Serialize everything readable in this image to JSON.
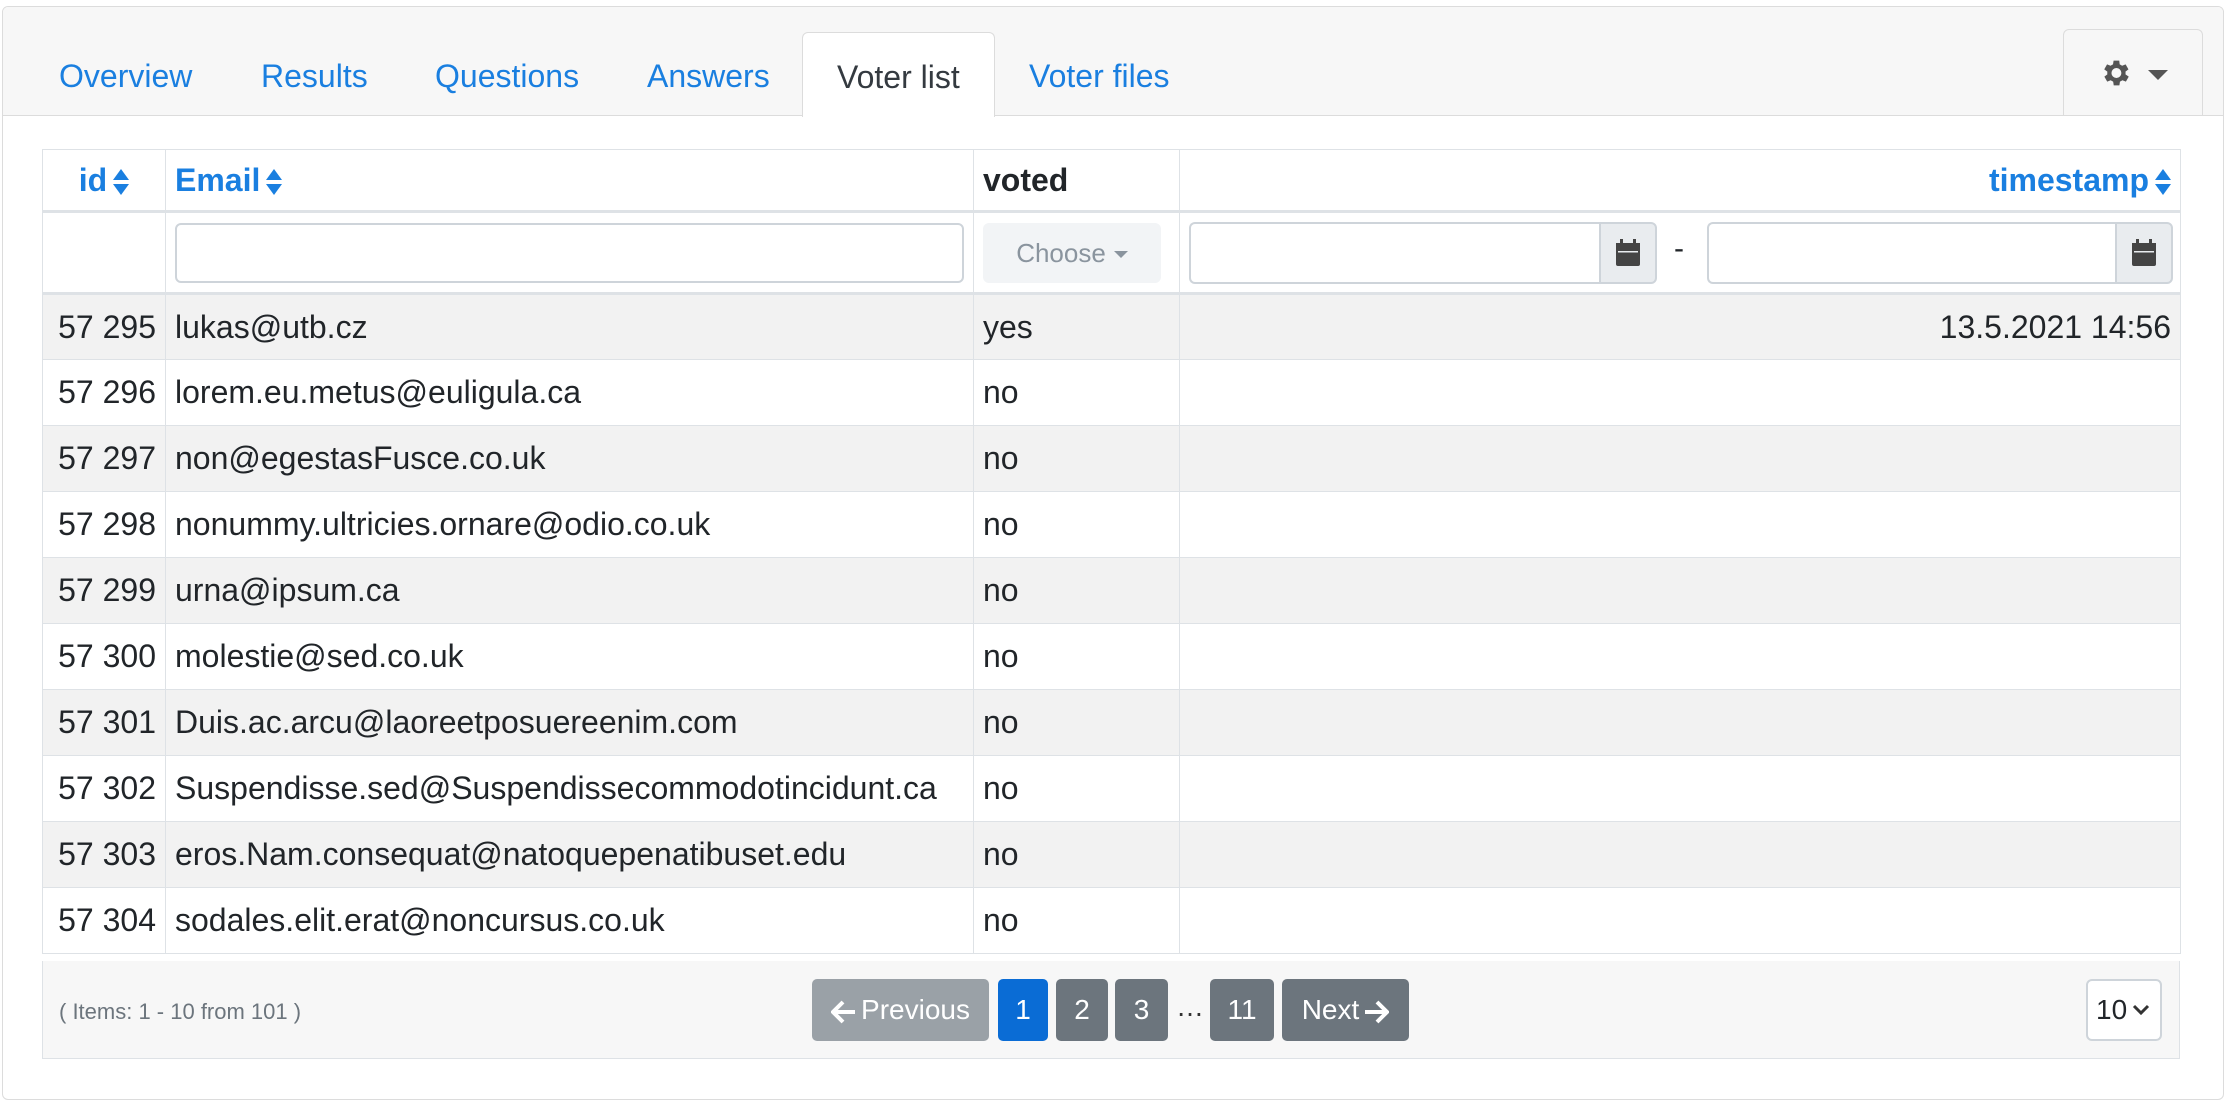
{
  "tabs": [
    {
      "label": "Overview"
    },
    {
      "label": "Results"
    },
    {
      "label": "Questions"
    },
    {
      "label": "Answers"
    },
    {
      "label": "Voter list",
      "active": true
    },
    {
      "label": "Voter files"
    }
  ],
  "settings_icon": "gear-icon",
  "table": {
    "headers": {
      "id": "id",
      "email": "Email",
      "voted": "voted",
      "timestamp": "timestamp"
    },
    "filters": {
      "voted_placeholder": "Choose",
      "date_separator": "-"
    },
    "rows": [
      {
        "id": "57 295",
        "email": "lukas@utb.cz",
        "voted": "yes",
        "timestamp": "13.5.2021 14:56"
      },
      {
        "id": "57 296",
        "email": "lorem.eu.metus@euligula.ca",
        "voted": "no",
        "timestamp": ""
      },
      {
        "id": "57 297",
        "email": "non@egestasFusce.co.uk",
        "voted": "no",
        "timestamp": ""
      },
      {
        "id": "57 298",
        "email": "nonummy.ultricies.ornare@odio.co.uk",
        "voted": "no",
        "timestamp": ""
      },
      {
        "id": "57 299",
        "email": "urna@ipsum.ca",
        "voted": "no",
        "timestamp": ""
      },
      {
        "id": "57 300",
        "email": "molestie@sed.co.uk",
        "voted": "no",
        "timestamp": ""
      },
      {
        "id": "57 301",
        "email": "Duis.ac.arcu@laoreetposuereenim.com",
        "voted": "no",
        "timestamp": ""
      },
      {
        "id": "57 302",
        "email": "Suspendisse.sed@Suspendissecommodotincidunt.ca",
        "voted": "no",
        "timestamp": ""
      },
      {
        "id": "57 303",
        "email": "eros.Nam.consequat@natoquepenatibuset.edu",
        "voted": "no",
        "timestamp": ""
      },
      {
        "id": "57 304",
        "email": "sodales.elit.erat@noncursus.co.uk",
        "voted": "no",
        "timestamp": ""
      }
    ]
  },
  "pagination": {
    "items_info": "( Items: 1 - 10 from 101 )",
    "previous": "Previous",
    "next": "Next",
    "pages": [
      "1",
      "2",
      "3",
      "11"
    ],
    "ellipsis": "…",
    "current_page": "1",
    "per_page": "10"
  }
}
